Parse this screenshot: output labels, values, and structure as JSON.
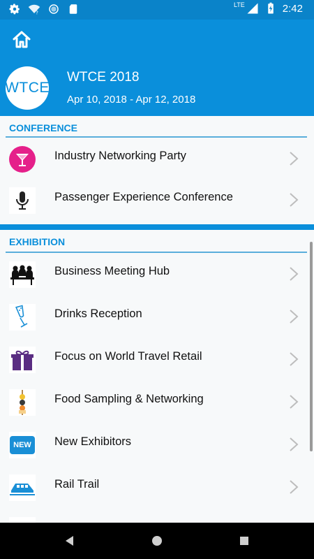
{
  "status_bar": {
    "time": "2:42",
    "network": "LTE",
    "icons": [
      "gear-icon",
      "wifi-icon",
      "circle-icon",
      "sd-card-icon",
      "signal-icon",
      "battery-icon"
    ]
  },
  "app_bar": {
    "icon": "home-icon"
  },
  "event": {
    "logo_text": "WTCE",
    "title": "WTCE 2018",
    "dates": "Apr 10, 2018 - Apr 12, 2018"
  },
  "sections": [
    {
      "title": "CONFERENCE",
      "items": [
        {
          "label": "Industry Networking Party",
          "icon": "cocktail-icon"
        },
        {
          "label": "Passenger Experience Conference",
          "icon": "microphone-icon"
        }
      ]
    },
    {
      "title": "EXHIBITION",
      "items": [
        {
          "label": "Business Meeting Hub",
          "icon": "meeting-icon"
        },
        {
          "label": "Drinks Reception",
          "icon": "champagne-icon"
        },
        {
          "label": "Focus on World Travel Retail",
          "icon": "gift-icon"
        },
        {
          "label": "Food Sampling & Networking",
          "icon": "food-skewer-icon"
        },
        {
          "label": "New Exhibitors",
          "icon": "new-badge-icon",
          "badge_text": "NEW"
        },
        {
          "label": "Rail Trail",
          "icon": "train-icon"
        }
      ]
    }
  ],
  "colors": {
    "primary": "#0a8fdb",
    "status_bar": "#0a83c9",
    "cocktail_bg": "#e5208a",
    "gift": "#5a2d82"
  }
}
